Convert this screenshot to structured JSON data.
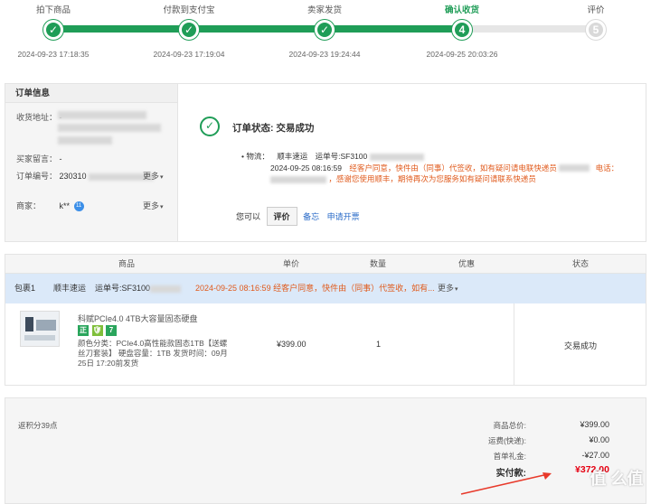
{
  "steps": [
    {
      "label": "拍下商品",
      "marker": "✓",
      "time": "2024-09-23 17:18:35"
    },
    {
      "label": "付款到支付宝",
      "marker": "✓",
      "time": "2024-09-23 17:19:04"
    },
    {
      "label": "卖家发货",
      "marker": "✓",
      "time": "2024-09-23 19:24:44"
    },
    {
      "label": "确认收货",
      "marker": "4",
      "time": "2024-09-25 20:03:26"
    },
    {
      "label": "评价",
      "marker": "5",
      "time": ""
    }
  ],
  "progress": {
    "completed_fraction": 0.75,
    "fill_color": "#1f9d57",
    "track_color": "#e6e6e6"
  },
  "order_info": {
    "header": "订单信息",
    "address_label": "收货地址：",
    "address_value": "-",
    "message_label": "买家留言：",
    "message_value": "-",
    "order_no_label": "订单编号：",
    "order_no_value": "230310",
    "order_more": "更多",
    "merchant_label": "商家：",
    "merchant_value": "k**",
    "merchant_badge": "11",
    "merchant_more": "更多"
  },
  "status": {
    "icon": "check-circle-icon",
    "text": "订单状态: 交易成功",
    "logistics_label": "物流：",
    "carrier": "顺丰速运",
    "tracking_label": "运单号:SF3100",
    "latest_time": "2024-09-25 08:16:59",
    "latest_msg_1": "经客户同意，快件由（同事）代签收，如有疑问请电联快递员",
    "latest_msg_2": "电话：",
    "latest_msg_3": "，感谢您使用顺丰，期待再次为您服务如有疑问请联系快递员",
    "actions_prefix": "您可以",
    "evaluate_btn": "评价",
    "memo_link": "备忘",
    "invoice_link": "申请开票"
  },
  "goods": {
    "columns": [
      "商品",
      "单价",
      "数量",
      "优惠",
      "状态"
    ],
    "package": {
      "name": "包裹1",
      "carrier": "顺丰速运",
      "tracking": "运单号:SF3100",
      "latest": "2024-09-25 08:16:59  经客户同意，快件由（同事）代签收，如有...",
      "more": "更多"
    },
    "item": {
      "title": "科赋PCIe4.0 4TB大容量固态硬盘",
      "tags": [
        "正",
        "🛡",
        "7"
      ],
      "desc": "颜色分类：PCIe4.0高性能款固态1TB【送螺丝刀套装】 硬盘容量：1TB 发货时间：09月25日 17:20前发货",
      "price": "¥399.00",
      "qty": "1",
      "status": "交易成功"
    }
  },
  "summary": {
    "points": "返积分39点",
    "rows": [
      {
        "label": "商品总价:",
        "value": "¥399.00"
      },
      {
        "label": "运费(快递):",
        "value": "¥0.00"
      },
      {
        "label": "首单礼金:",
        "value": "-¥27.00"
      }
    ],
    "total_label": "实付款:",
    "total_value": "¥372.00",
    "total_color": "#e60012"
  },
  "watermark": "值 么值得买"
}
